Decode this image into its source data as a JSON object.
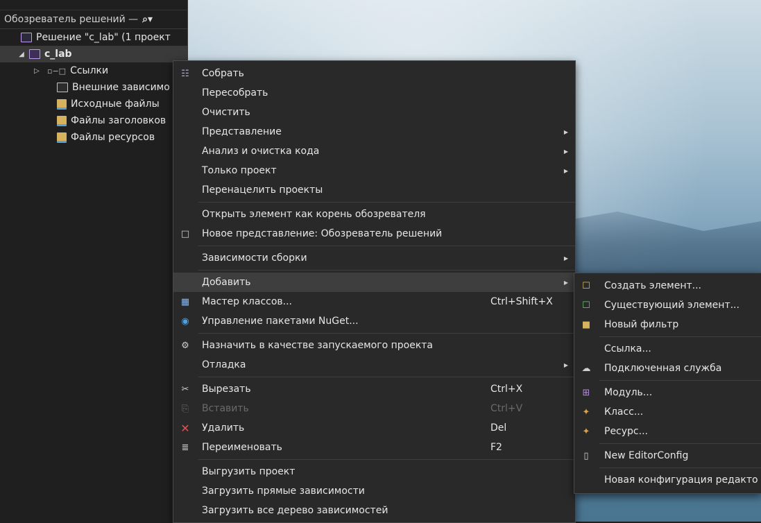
{
  "explorer": {
    "title": "Обозреватель решений — ",
    "search_icon": "search-icon",
    "solution": "Решение \"c_lab\" (1 проект",
    "project": "c_lab",
    "nodes": [
      "Ссылки",
      "Внешние зависимо",
      "Исходные файлы",
      "Файлы заголовков",
      "Файлы ресурсов"
    ]
  },
  "context_menu": {
    "items": [
      {
        "label": "Собрать",
        "icon": "build-icon"
      },
      {
        "label": "Пересобрать"
      },
      {
        "label": "Очистить"
      },
      {
        "label": "Представление",
        "submenu": true
      },
      {
        "label": "Анализ и очистка кода",
        "submenu": true
      },
      {
        "label": "Только проект",
        "submenu": true
      },
      {
        "label": "Перенацелить проекты"
      },
      {
        "label": "Открыть элемент как корень обозревателя"
      },
      {
        "label": "Новое представление: Обозреватель решений",
        "icon": "new-view-icon"
      },
      {
        "label": "Зависимости сборки",
        "submenu": true
      },
      {
        "label": "Добавить",
        "submenu": true,
        "highlighted": true
      },
      {
        "label": "Мастер классов...",
        "shortcut": "Ctrl+Shift+X",
        "icon": "class-wizard-icon"
      },
      {
        "label": "Управление пакетами NuGet...",
        "icon": "nuget-icon"
      },
      {
        "label": "Назначить в качестве запускаемого проекта",
        "icon": "gear-icon"
      },
      {
        "label": "Отладка",
        "submenu": true
      },
      {
        "label": "Вырезать",
        "shortcut": "Ctrl+X",
        "icon": "cut-icon"
      },
      {
        "label": "Вставить",
        "shortcut": "Ctrl+V",
        "icon": "paste-icon",
        "disabled": true
      },
      {
        "label": "Удалить",
        "shortcut": "Del",
        "icon": "delete-icon"
      },
      {
        "label": "Переименовать",
        "shortcut": "F2",
        "icon": "rename-icon"
      },
      {
        "label": "Выгрузить проект"
      },
      {
        "label": "Загрузить прямые зависимости"
      },
      {
        "label": "Загрузить все дерево зависимостей"
      }
    ]
  },
  "add_submenu": {
    "items": [
      {
        "label": "Создать элемент...",
        "icon": "new-item-icon"
      },
      {
        "label": "Существующий элемент...",
        "icon": "existing-item-icon"
      },
      {
        "label": "Новый фильтр",
        "icon": "new-filter-icon"
      },
      {
        "label": "Ссылка..."
      },
      {
        "label": "Подключенная служба",
        "icon": "connected-service-icon"
      },
      {
        "label": "Модуль...",
        "icon": "module-icon"
      },
      {
        "label": "Класс...",
        "icon": "class-icon"
      },
      {
        "label": "Ресурс...",
        "icon": "resource-icon"
      },
      {
        "label": "New EditorConfig",
        "icon": "file-icon"
      },
      {
        "label": "Новая конфигурация редакто"
      }
    ]
  },
  "colors": {
    "accent": "#c09cf0",
    "menu_bg": "#292929",
    "highlight": "#3e3e3e",
    "delete_red": "#e05252"
  }
}
